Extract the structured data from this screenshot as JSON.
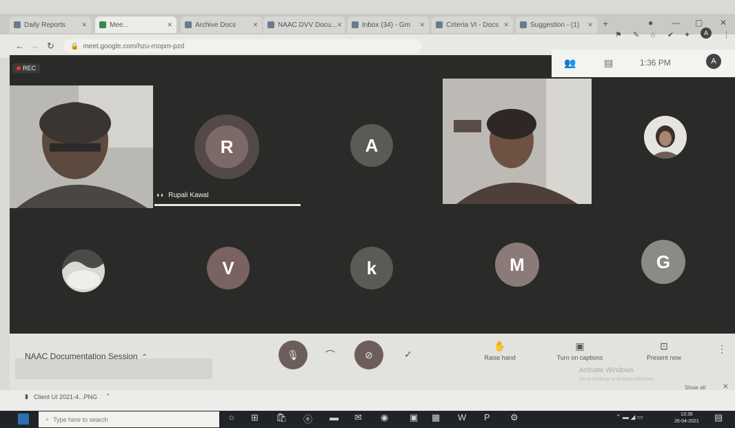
{
  "browser": {
    "tabs": [
      {
        "label": "Daily Reports"
      },
      {
        "label": "Mee..."
      },
      {
        "label": "Archive Docs"
      },
      {
        "label": "NAAC DVV Docu..."
      },
      {
        "label": "Inbox (34) - Gm"
      },
      {
        "label": "Criteria VI - Docs"
      },
      {
        "label": "Suggestion - (1)"
      }
    ],
    "new_tab": "+",
    "url": "meet.google.com/hzu-rnopm-pzd"
  },
  "meet": {
    "rec_label": "REC",
    "time": "1:36 PM",
    "speaker_name": "Rupali Kawal",
    "participants": [
      {
        "initial": "R",
        "color": "#7b6a67"
      },
      {
        "initial": "A",
        "color": "#5c5a57"
      },
      {
        "initial": "V",
        "color": "#7a6260"
      },
      {
        "initial": "k",
        "color": "#5c5a57"
      },
      {
        "initial": "M",
        "color": "#8a7b78"
      },
      {
        "initial": "G",
        "color": "#8a8a86"
      }
    ],
    "meeting_title": "NAAC Documentation Session",
    "actions": [
      {
        "label": "Raise hand"
      },
      {
        "label": "Turn on captions"
      },
      {
        "label": "Present now"
      }
    ],
    "faded_text": "Activate Windows",
    "faded_subtext": "Go to Settings to activate Windows."
  },
  "downloads": {
    "file": "Client UI 2021-4...PNG",
    "show_all": "Show all"
  },
  "taskbar": {
    "search_placeholder": "Type here to search",
    "clock_time": "13:36",
    "clock_date": "26-04-2021"
  }
}
